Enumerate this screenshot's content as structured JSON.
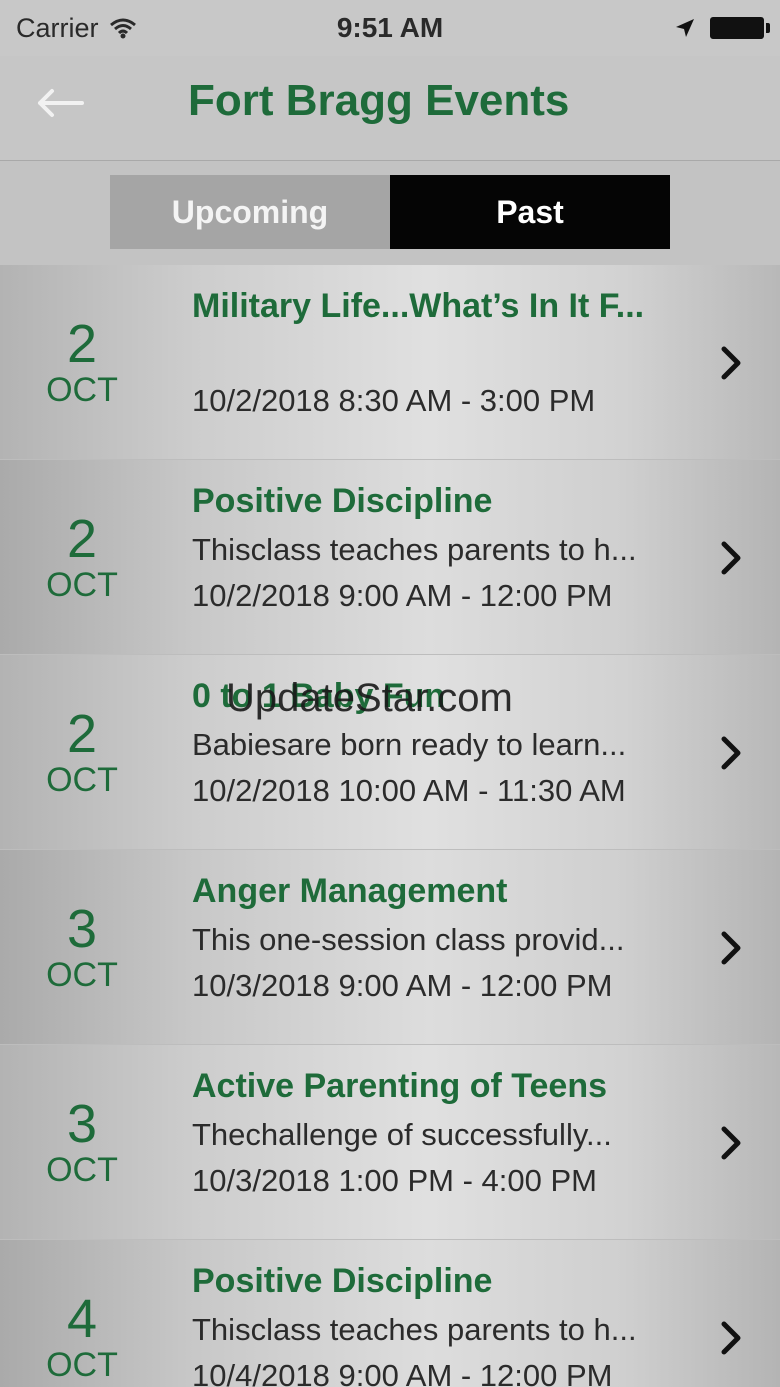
{
  "status_bar": {
    "carrier": "Carrier",
    "time": "9:51 AM",
    "icons": [
      "wifi-icon",
      "location-arrow-icon",
      "battery-icon"
    ]
  },
  "nav": {
    "title": "Fort Bragg Events",
    "back_icon": "back-arrow-icon"
  },
  "segments": {
    "upcoming": "Upcoming",
    "past": "Past",
    "selected": "Past"
  },
  "events": [
    {
      "day": "2",
      "month": "OCT",
      "title": "Military Life...What’s In It F...",
      "description": "",
      "time": "10/2/2018 8:30 AM - 3:00 PM"
    },
    {
      "day": "2",
      "month": "OCT",
      "title": "Positive Discipline",
      "description": "Thisclass teaches parents to h...",
      "time": "10/2/2018 9:00 AM - 12:00 PM"
    },
    {
      "day": "2",
      "month": "OCT",
      "title": "0 to 1 Baby Fun",
      "description": "Babiesare born ready to learn...",
      "time": "10/2/2018 10:00 AM - 11:30 AM"
    },
    {
      "day": "3",
      "month": "OCT",
      "title": "Anger Management",
      "description": "This one-session class provid...",
      "time": "10/3/2018 9:00 AM - 12:00 PM"
    },
    {
      "day": "3",
      "month": "OCT",
      "title": "Active Parenting of Teens",
      "description": "Thechallenge of successfully...",
      "time": "10/3/2018 1:00 PM - 4:00 PM"
    },
    {
      "day": "4",
      "month": "OCT",
      "title": "Positive Discipline",
      "description": "Thisclass teaches parents to h...",
      "time": "10/4/2018 9:00 AM - 12:00 PM"
    }
  ],
  "watermark": "UpdateStar.com",
  "colors": {
    "accent_green": "#1e6b3a",
    "segment_selected": "#050505",
    "segment_unselected": "#a5a5a5"
  }
}
